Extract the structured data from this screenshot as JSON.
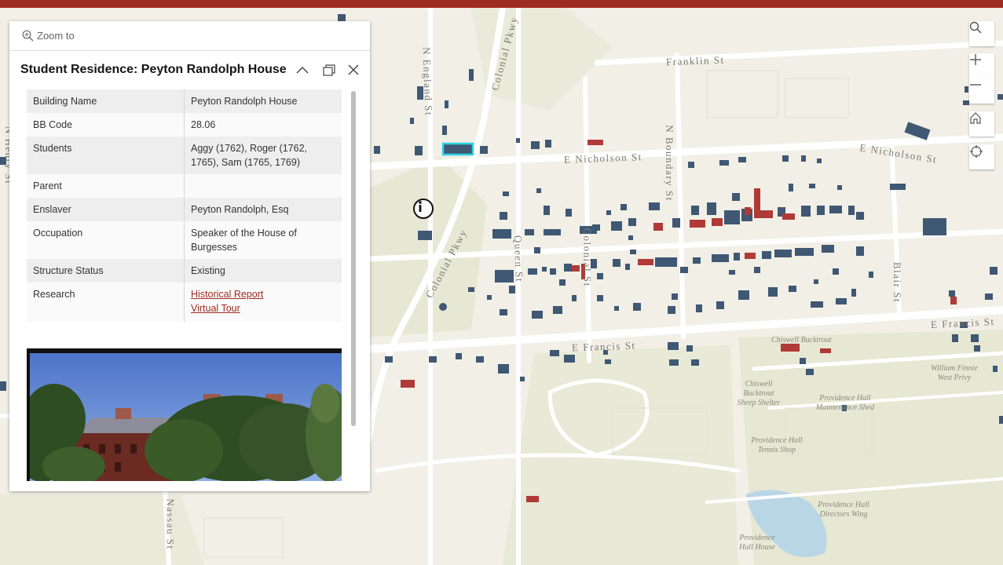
{
  "popup": {
    "zoom_to_label": "Zoom to",
    "title": "Student Residence: Peyton Randolph House",
    "fields": [
      {
        "key": "Building Name",
        "value": "Peyton Randolph House"
      },
      {
        "key": "BB Code",
        "value": "28.06"
      },
      {
        "key": "Students",
        "value": "Aggy (1762), Roger (1762, 1765), Sam (1765, 1769)"
      },
      {
        "key": "Parent",
        "value": ""
      },
      {
        "key": "Enslaver",
        "value": "Peyton Randolph, Esq"
      },
      {
        "key": "Occupation",
        "value": "Speaker of the House of Burgesses"
      },
      {
        "key": "Structure Status",
        "value": "Existing"
      }
    ],
    "research": {
      "key": "Research",
      "links": [
        "Historical Report",
        "Virtual Tour"
      ]
    },
    "icons": {
      "zoom": "magnifier-plus-icon",
      "collapse": "chevron-up-icon",
      "dock": "dock-icon",
      "close": "close-icon"
    }
  },
  "map": {
    "street_labels": [
      "Franklin St",
      "E Nicholson St",
      "E Nicholson St",
      "N Boundary St",
      "N England St",
      "Colonial Pkwy",
      "Colonial Pkwy",
      "Queen St",
      "Colonial St",
      "Blair St",
      "E Francis St",
      "E Francis St",
      "Nassau St",
      "N Henry St"
    ],
    "poi_labels": [
      "Chiswell Bucktrout",
      "Chiswell Bucktrout Sheep Shelter",
      "Providence Hall Maintenance Shed",
      "William Finnie West Privy",
      "Providence Hall Tennis Shop",
      "Providence Hall Directors Wing",
      "Providence Hall House"
    ],
    "colors": {
      "building_blue": "#3f5873",
      "building_red": "#b03a37",
      "highlight": "#2ed3e6",
      "road": "#ffffff",
      "land": "#f1efe6",
      "brand_bar": "#9e2c23"
    }
  },
  "toolbar": {
    "buttons": [
      "search-icon",
      "zoom-in-icon",
      "zoom-out-icon",
      "home-icon",
      "locate-icon"
    ]
  }
}
